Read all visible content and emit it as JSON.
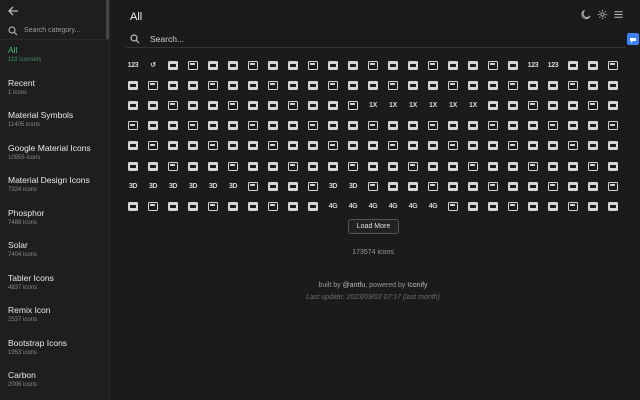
{
  "sidebar": {
    "search_placeholder": "Search category...",
    "categories": [
      {
        "name": "All",
        "count": "118 iconsets"
      },
      {
        "name": "Recent",
        "count": "1 icons"
      },
      {
        "name": "Material Symbols",
        "count": "11405 icons"
      },
      {
        "name": "Google Material Icons",
        "count": "10955 icons"
      },
      {
        "name": "Material Design Icons",
        "count": "7334 icons"
      },
      {
        "name": "Phosphor",
        "count": "7488 icons"
      },
      {
        "name": "Solar",
        "count": "7404 icons"
      },
      {
        "name": "Tabler Icons",
        "count": "4837 icons"
      },
      {
        "name": "Remix Icon",
        "count": "2537 icons"
      },
      {
        "name": "Bootstrap Icons",
        "count": "1953 icons"
      },
      {
        "name": "Carbon",
        "count": "2006 icons"
      }
    ]
  },
  "header": {
    "title": "All",
    "icons": [
      "moon-icon",
      "gear-icon",
      "menu-icon"
    ]
  },
  "search": {
    "placeholder": "Search..."
  },
  "grid": {
    "rows": 8,
    "columns": 25,
    "text_glyphs": {
      "0": "123",
      "1": "↺",
      "20": "123",
      "21": "123",
      "62": "1X",
      "63": "1X",
      "64": "1X",
      "65": "1X",
      "66": "1X",
      "67": "1X",
      "150": "3D",
      "151": "3D",
      "152": "3D",
      "153": "3D",
      "154": "3D",
      "155": "3D",
      "160": "3D",
      "161": "3D",
      "185": "4G",
      "186": "4G",
      "187": "4G",
      "188": "4G",
      "189": "4G",
      "190": "4G"
    }
  },
  "load_more_label": "Load More",
  "icon_count": "173574 icons",
  "footer": {
    "prefix": "built by ",
    "author": "@antfu",
    "middle": ", powered by ",
    "powered": "Iconify",
    "last_update": "Last update: 2023/09/03 07:17 (last month)"
  },
  "colors": {
    "accent": "#3fbf7f",
    "background": "#1b1b1b",
    "badge": "#3b82f6"
  }
}
